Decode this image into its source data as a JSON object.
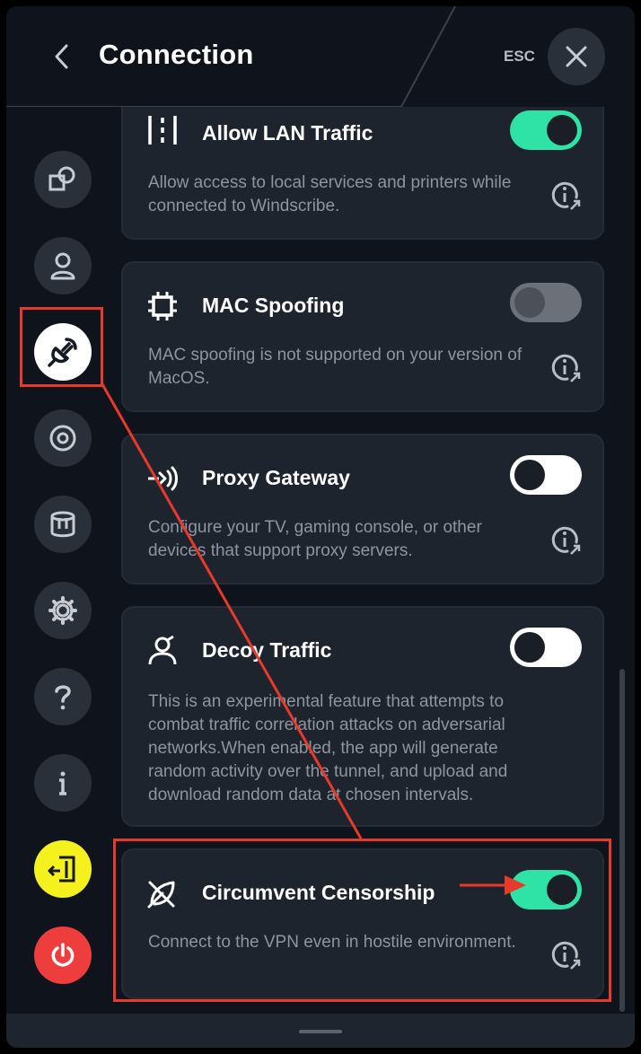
{
  "header": {
    "title": "Connection",
    "esc_label": "ESC"
  },
  "sidebar": {
    "items": [
      {
        "name": "connect",
        "icon": "overlapping-squares-icon"
      },
      {
        "name": "account",
        "icon": "user-icon"
      },
      {
        "name": "connection",
        "icon": "plug-icon",
        "active": true
      },
      {
        "name": "robert",
        "icon": "target-icon"
      },
      {
        "name": "advanced",
        "icon": "database-icon"
      },
      {
        "name": "general",
        "icon": "gear-icon"
      },
      {
        "name": "help",
        "icon": "question-icon"
      },
      {
        "name": "about",
        "icon": "info-icon"
      },
      {
        "name": "logout",
        "icon": "logout-door-icon"
      },
      {
        "name": "quit",
        "icon": "power-icon"
      }
    ]
  },
  "cards": [
    {
      "title": "Allow LAN Traffic",
      "description": "Allow access to local services and printers while connected to Windscribe.",
      "toggle": "on"
    },
    {
      "title": "MAC Spoofing",
      "description": "MAC spoofing is not supported on your version of MacOS.",
      "toggle": "disabled"
    },
    {
      "title": "Proxy Gateway",
      "description": "Configure your TV, gaming console, or other devices that support proxy servers.",
      "toggle": "off"
    },
    {
      "title": "Decoy Traffic",
      "description": "This is an experimental feature that attempts to combat traffic correlation attacks on adversarial networks.When enabled, the app will generate random activity over the tunnel, and upload and download random data at chosen intervals.",
      "toggle": "off"
    },
    {
      "title": "Circumvent Censorship",
      "description": "Connect to the VPN even in hostile environment.",
      "toggle": "on"
    }
  ],
  "colors": {
    "accent_green": "#2fe3a6",
    "annotation_red": "#e8392b",
    "logout_yellow": "#f4f11e",
    "power_red": "#ee3d3d"
  }
}
